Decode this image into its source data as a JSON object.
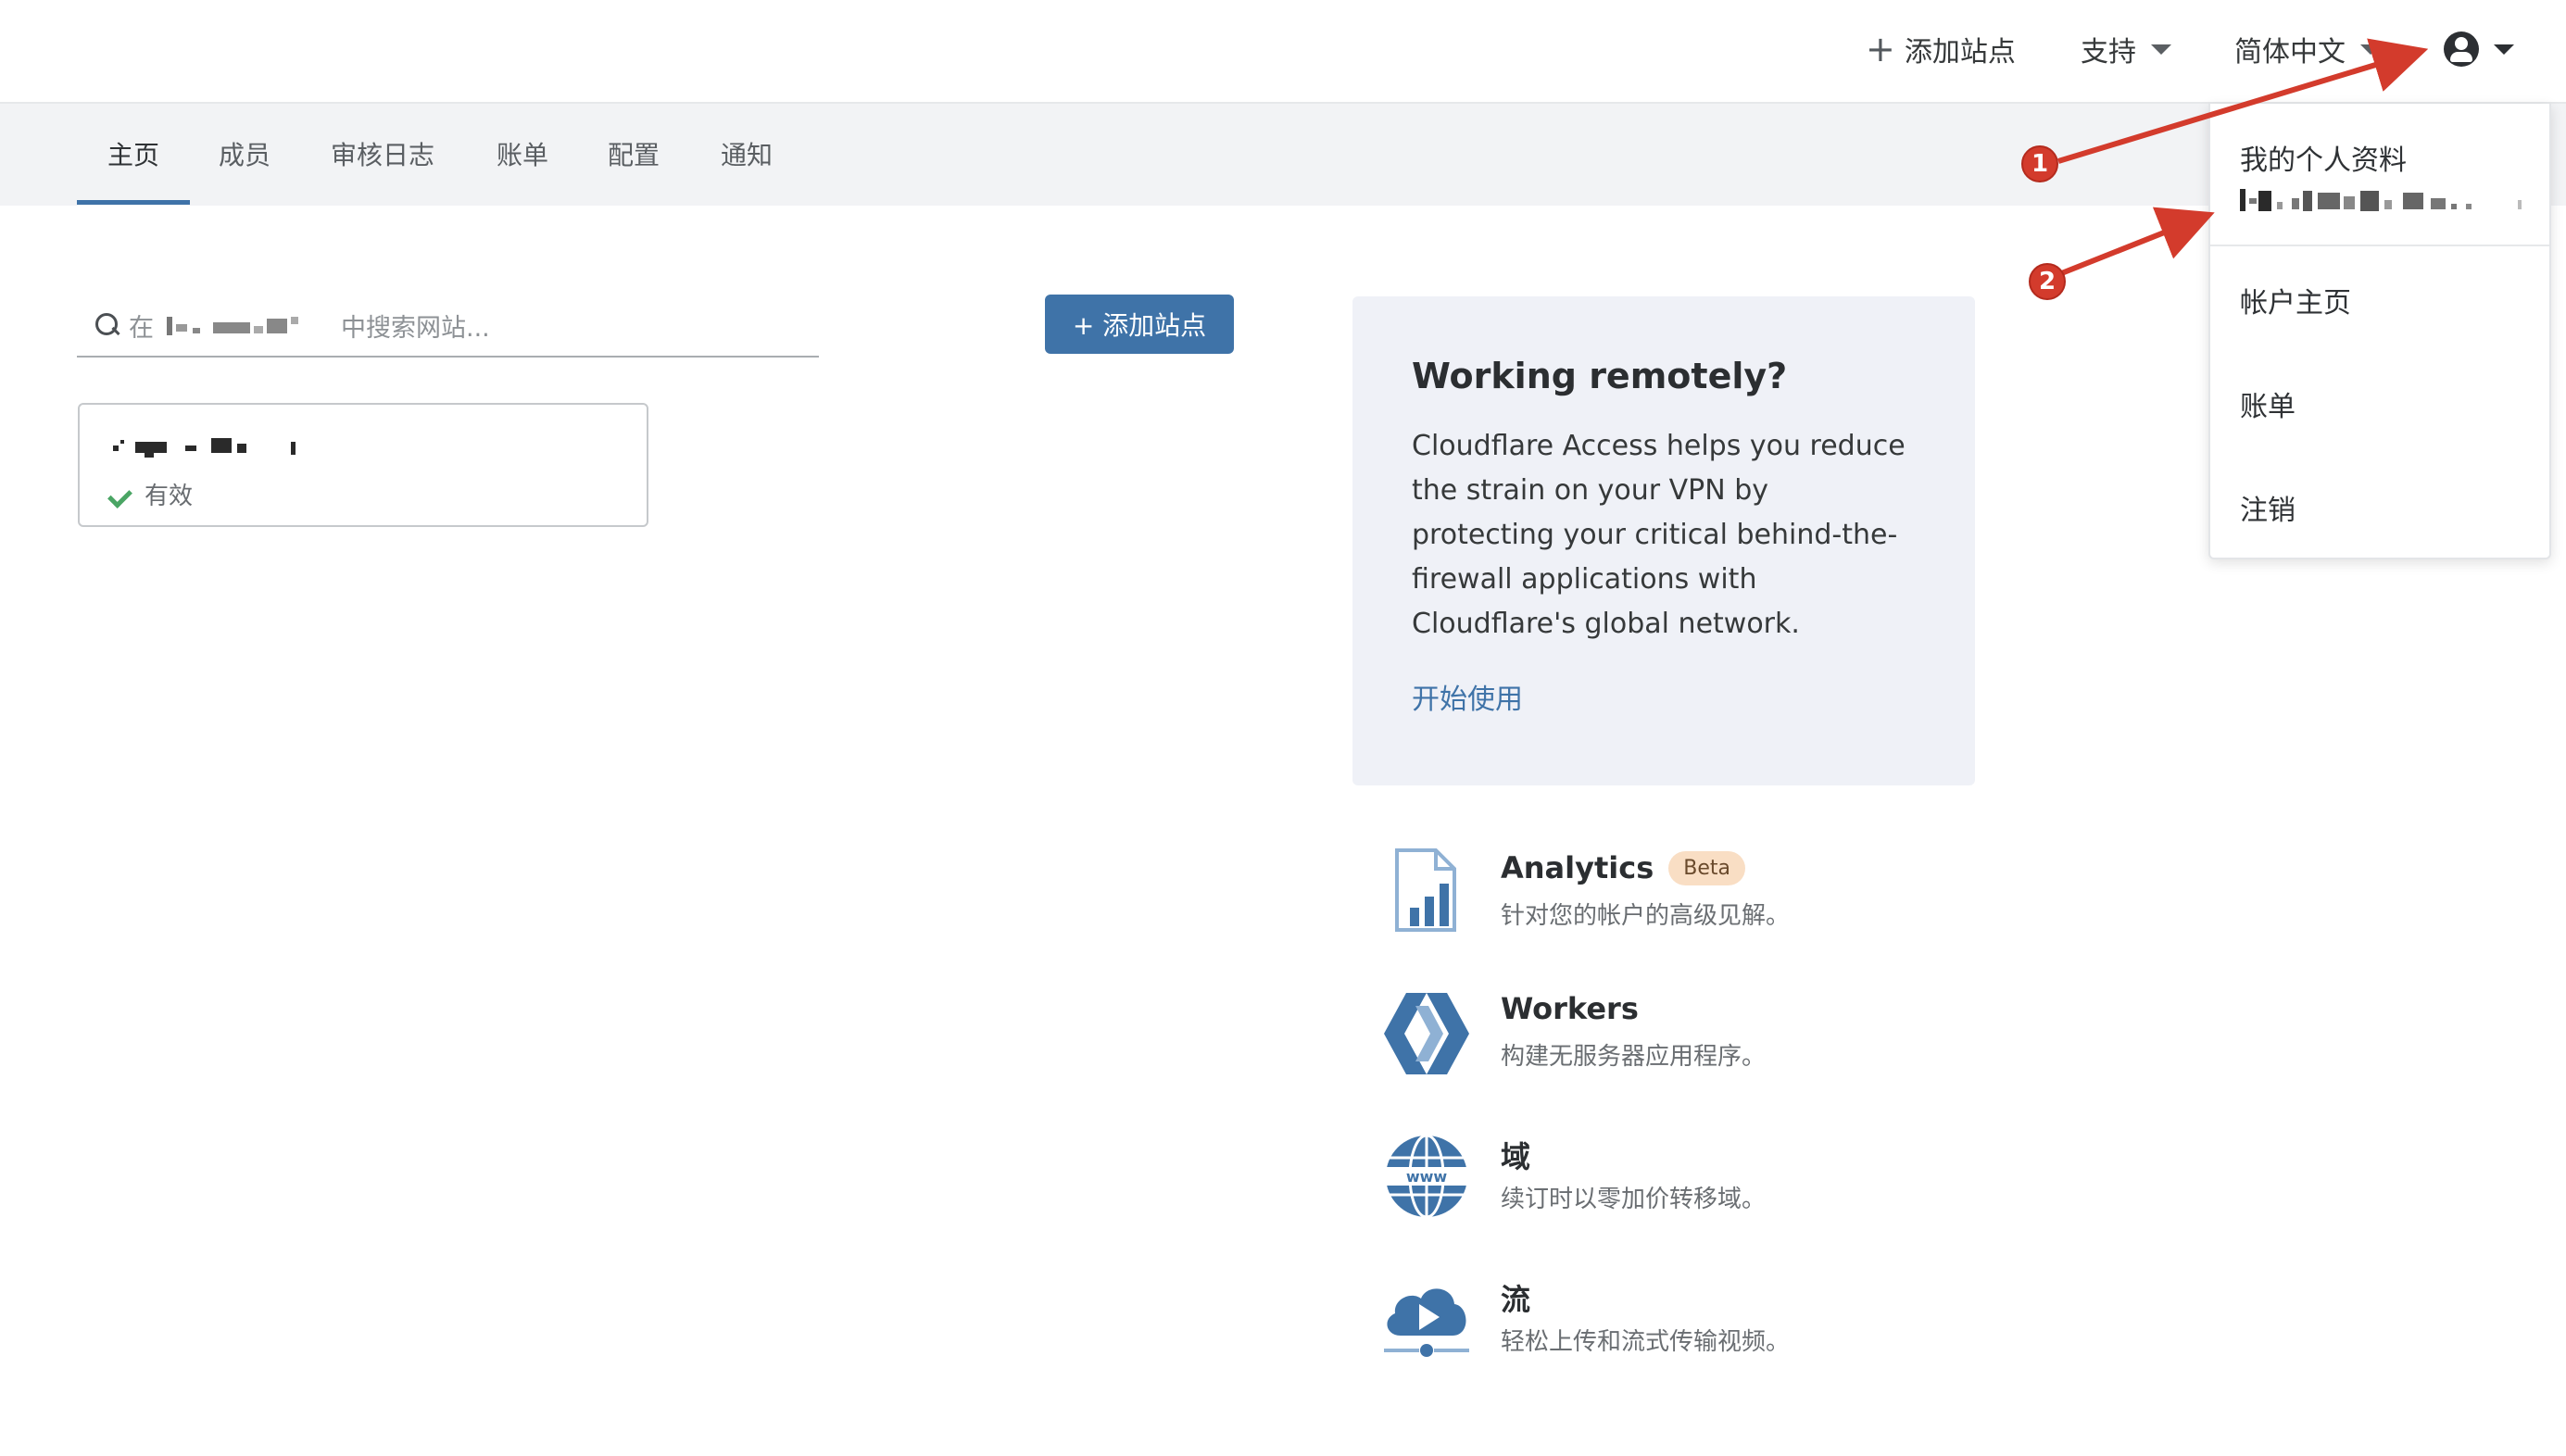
{
  "header": {
    "add_site": "添加站点",
    "support": "支持",
    "language": "简体中文"
  },
  "tabs": [
    "主页",
    "成员",
    "审核日志",
    "账单",
    "配置",
    "通知"
  ],
  "search": {
    "placeholder_prefix": "在",
    "placeholder_suffix": "中搜索网站..."
  },
  "add_site_button": "+ 添加站点",
  "site": {
    "status": "有效"
  },
  "remote_card": {
    "title": "Working remotely?",
    "body": "Cloudflare Access helps you reduce the strain on your VPN by protecting your critical behind-the-firewall applications with Cloudflare's global network.",
    "link": "开始使用"
  },
  "products": [
    {
      "name": "Analytics",
      "badge": "Beta",
      "desc": "针对您的帐户的高级见解。",
      "icon": "analytics-icon"
    },
    {
      "name": "Workers",
      "desc": "构建无服务器应用程序。",
      "icon": "workers-icon"
    },
    {
      "name": "域",
      "desc": "续订时以零加价转移域。",
      "icon": "globe-www-icon"
    },
    {
      "name": "流",
      "desc": "轻松上传和流式传输视频。",
      "icon": "cloud-play-icon"
    }
  ],
  "dropdown": {
    "profile": "我的个人资料",
    "account_home": "帐户主页",
    "billing": "账单",
    "logout": "注销"
  },
  "annotations": [
    "1",
    "2"
  ],
  "colors": {
    "accent": "#3f73a8",
    "annotation": "#d33b2c",
    "beta_badge": "#f9dec4",
    "status_ok": "#4aa564"
  }
}
